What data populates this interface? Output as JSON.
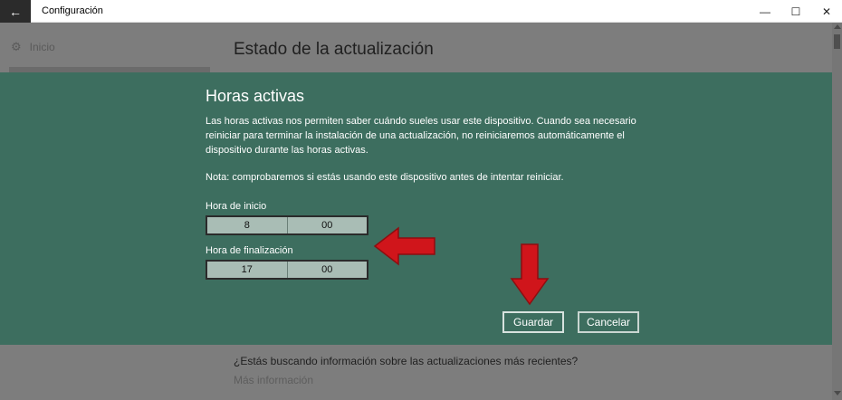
{
  "window": {
    "title": "Configuración",
    "back_glyph": "←",
    "minimize_glyph": "—",
    "maximize_glyph": "☐",
    "close_glyph": "✕"
  },
  "sidebar": {
    "home_label": "Inicio",
    "home_icon": "gear-icon"
  },
  "background": {
    "heading": "Estado de la actualización",
    "question": "¿Estás buscando información sobre las actualizaciones más recientes?",
    "link": "Más información"
  },
  "dialog": {
    "title": "Horas activas",
    "description": "Las horas activas nos permiten saber cuándo sueles usar este dispositivo. Cuando sea necesario reiniciar para terminar la instalación de una actualización, no reiniciaremos automáticamente el dispositivo durante las horas activas.",
    "note": "Nota: comprobaremos si estás usando este dispositivo antes de intentar reiniciar.",
    "start": {
      "label": "Hora de inicio",
      "hour": "8",
      "minute": "00"
    },
    "end": {
      "label": "Hora de finalización",
      "hour": "17",
      "minute": "00"
    },
    "save_label": "Guardar",
    "cancel_label": "Cancelar"
  },
  "colors": {
    "dialog_bg": "#3d6e5f",
    "arrow": "#d0151b",
    "picker_bg": "#a9bdb5"
  }
}
